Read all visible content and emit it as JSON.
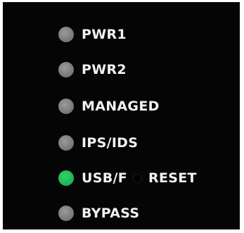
{
  "indicators": [
    {
      "label": "PWR1",
      "state": "off",
      "color": "#7d7d7d",
      "icon": "led-indicator-icon"
    },
    {
      "label": "PWR2",
      "state": "off",
      "color": "#7d7d7d",
      "icon": "led-indicator-icon"
    },
    {
      "label": "MANAGED",
      "state": "off",
      "color": "#7d7d7d",
      "icon": "led-indicator-icon"
    },
    {
      "label": "IPS/IDS",
      "state": "off",
      "color": "#7d7d7d",
      "icon": "led-indicator-icon"
    },
    {
      "label": "USB/F",
      "state": "on",
      "color": "#1fb955",
      "icon": "led-indicator-icon"
    },
    {
      "label": "BYPASS",
      "state": "off",
      "color": "#7d7d7d",
      "icon": "led-indicator-icon"
    }
  ],
  "reset": {
    "label": "RESET",
    "icon": "reset-pinhole-icon"
  },
  "colors": {
    "panel": "#050505",
    "text": "#f2f2f2"
  }
}
